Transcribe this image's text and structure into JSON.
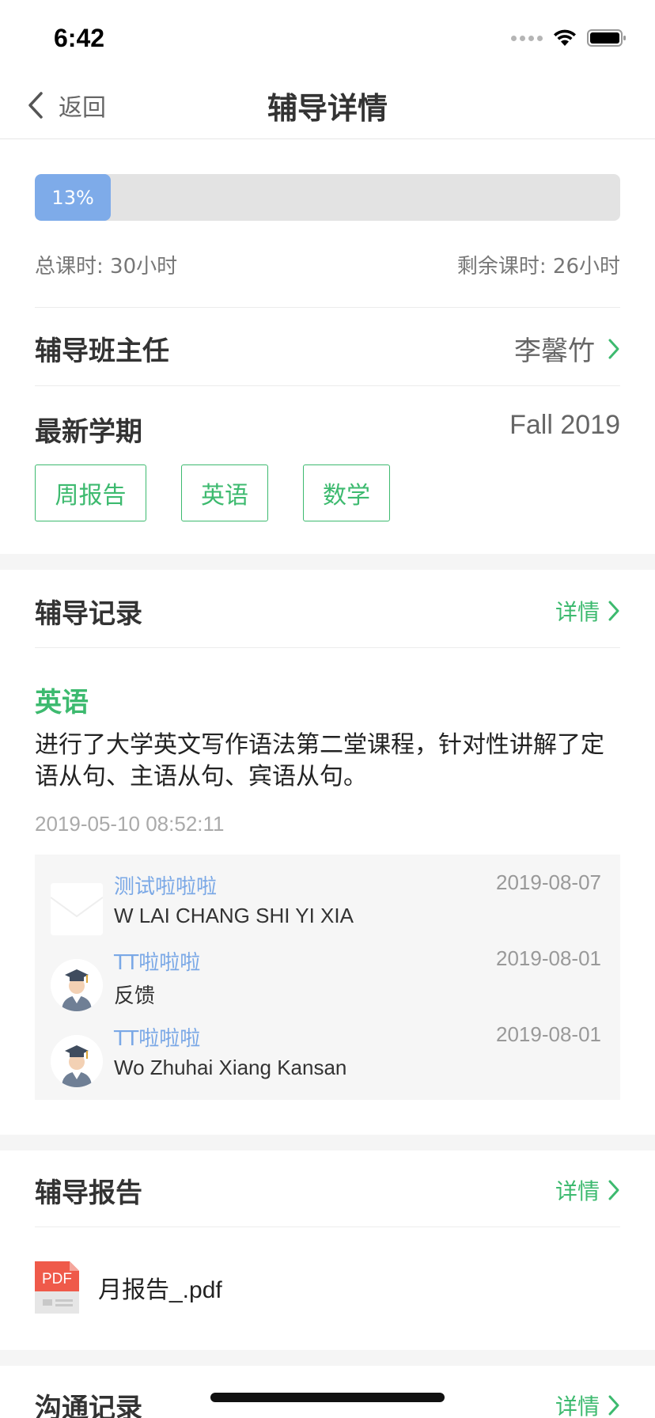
{
  "status_bar": {
    "time": "6:42"
  },
  "nav": {
    "back_label": "返回",
    "title": "辅导详情"
  },
  "progress": {
    "value": 0.13,
    "label": "13%"
  },
  "hours": {
    "total": "总课时: 30小时",
    "remaining": "剩余课时: 26小时"
  },
  "head_teacher": {
    "label": "辅导班主任",
    "name": "李馨竹"
  },
  "semester": {
    "label": "最新学期",
    "value": "Fall 2019"
  },
  "tags": [
    "周报告",
    "英语",
    "数学"
  ],
  "records": {
    "title": "辅导记录",
    "detail": "详情",
    "subject": "英语",
    "content": "进行了大学英文写作语法第二堂课程，针对性讲解了定语从句、主语从句、宾语从句。",
    "time": "2019-05-10 08:52:11",
    "comments": [
      {
        "name": "测试啦啦啦",
        "date": "2019-08-07",
        "text": "W LAI CHANG SHI YI XIA",
        "avatar": "blank-avatar"
      },
      {
        "name": "TT啦啦啦",
        "date": "2019-08-01",
        "text": "反馈",
        "avatar": "graduate-avatar"
      },
      {
        "name": "TT啦啦啦",
        "date": "2019-08-01",
        "text": "Wo Zhuhai Xiang Kansan",
        "avatar": "graduate-avatar"
      }
    ]
  },
  "reports": {
    "title": "辅导报告",
    "detail": "详情",
    "file_icon_label": "PDF",
    "file_name": "月报告_.pdf"
  },
  "communication": {
    "title": "沟通记录",
    "detail": "详情"
  },
  "colors": {
    "accent_green": "#3dba6f",
    "progress_blue": "#7eabe9",
    "name_blue": "#7aa8e6"
  }
}
